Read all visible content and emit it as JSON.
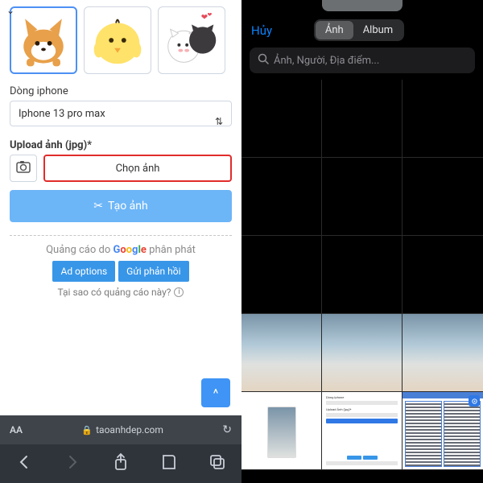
{
  "left": {
    "phone_model_label": "Dòng iphone",
    "phone_model_value": "Iphone 13 pro max",
    "upload_label": "Upload ảnh (jpg)*",
    "choose_label": "Chọn ảnh",
    "create_label": "Tạo ảnh",
    "ad": {
      "prefix": "Quảng cáo do ",
      "suffix": " phân phát",
      "goog_g": "G",
      "goog_o1": "o",
      "goog_o2": "o",
      "goog_g2": "g",
      "goog_l": "l",
      "goog_e": "e",
      "btn1": "Ad options",
      "btn2": "Gửi phản hồi",
      "why": "Tại sao có quảng cáo này?"
    },
    "address_url": "taoanhdep.com",
    "aa_label": "AA",
    "top_arrow": "^"
  },
  "right": {
    "cancel": "Hủy",
    "tab_photo": "Ảnh",
    "tab_album": "Album",
    "search_placeholder": "Ảnh, Người, Địa điểm..."
  }
}
